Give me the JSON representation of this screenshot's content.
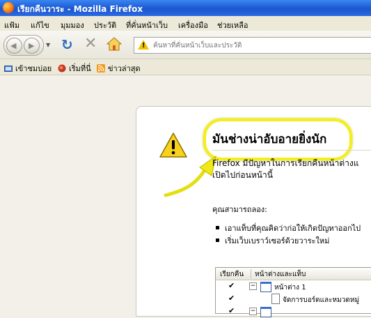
{
  "window": {
    "title": "เรียกคืนวาระ - Mozilla Firefox"
  },
  "menu": [
    "แฟ้ม",
    "แก้ไข",
    "มุมมอง",
    "ประวัติ",
    "ที่คั่นหน้าเว็บ",
    "เครื่องมือ",
    "ช่วยเหลือ"
  ],
  "urlbar": {
    "placeholder": "ค้นหาที่คั่นหน้าเว็บและประวัติ"
  },
  "bookmarks": [
    "เข้าชมบ่อย",
    "เริ่มที่นี่",
    "ข่าวล่าสุด"
  ],
  "page": {
    "headline": "มันช่างน่าอับอายยิ่งนัก",
    "para_line1": "Firefox มีปัญหาในการเรียกคืนหน้าต่างแ",
    "para_line2": "เปิดไปก่อนหน้านี้",
    "can_try": "คุณสามารถลอง:",
    "options": [
      "เอาแท็บที่คุณคิดว่าก่อให้เกิดปัญหาออกไป",
      "เริ่มเว็บเบราว์เซอร์ด้วยวาระใหม่"
    ]
  },
  "tabtree": {
    "col_restore": "เรียกคืน",
    "col_windows": "หน้าต่างและแท็บ",
    "rows": [
      {
        "check": "✔",
        "toggle": "−",
        "label": "หน้าต่าง 1"
      },
      {
        "check": "✔",
        "label": "จัดการบอร์ดและหมวดหมู่"
      },
      {
        "check": "✔",
        "toggle": "−"
      }
    ]
  },
  "colors": {
    "titlebar": "#1f5fd8",
    "highlight": "#f3ee1c",
    "warning": "#f2c200"
  }
}
